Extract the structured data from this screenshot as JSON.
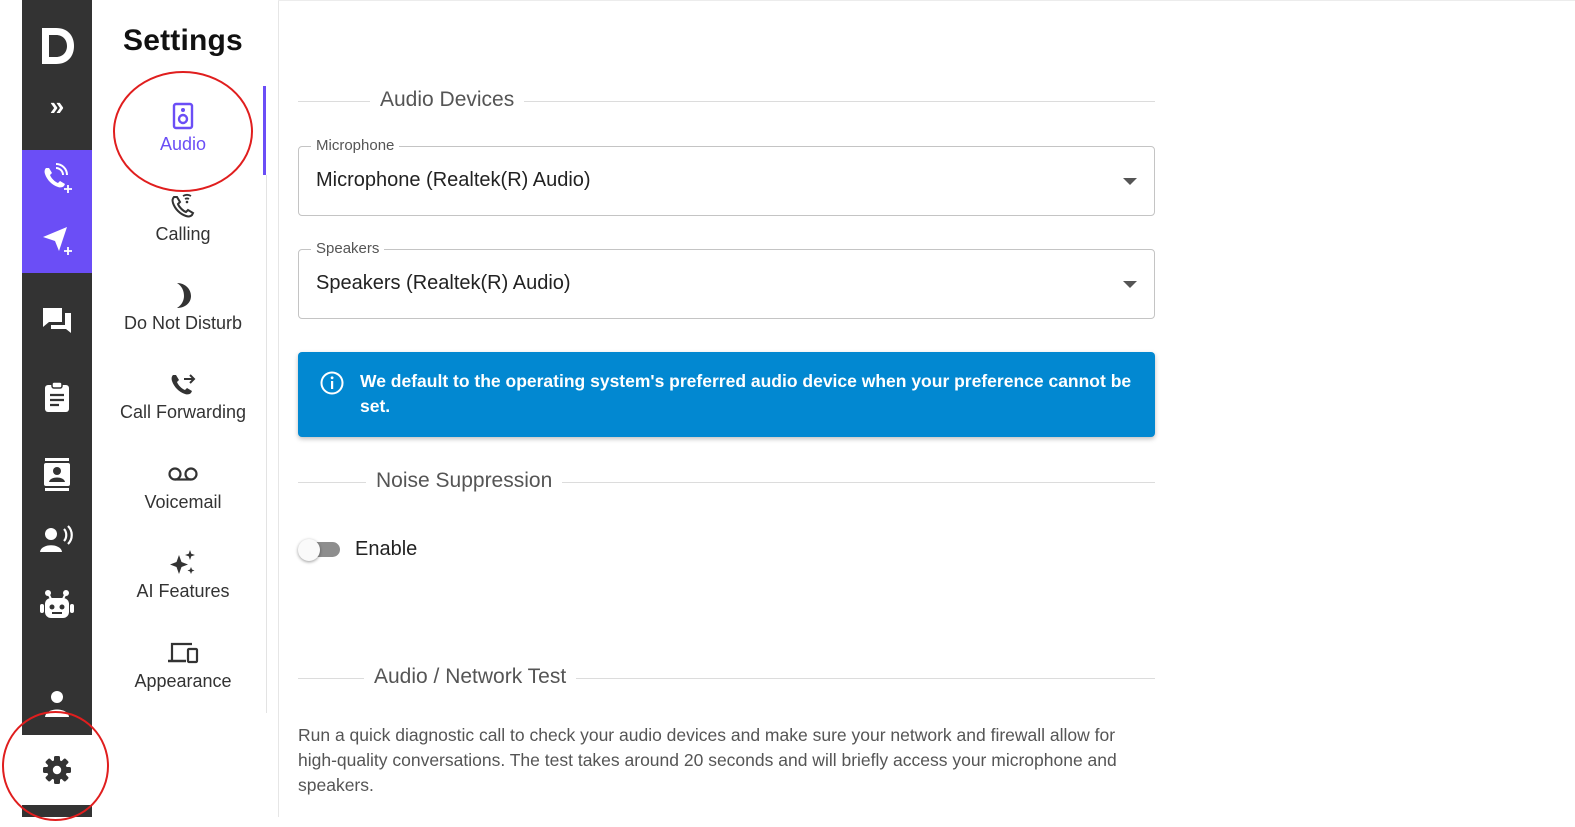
{
  "rail": {
    "logo": "D",
    "expand_glyph": "»",
    "icons": [
      "phone-add-icon",
      "send-add-icon",
      "chat-icon",
      "clipboard-icon",
      "contacts-icon",
      "speaking-person-icon",
      "robot-icon",
      "user-icon",
      "gear-icon"
    ]
  },
  "nav": {
    "title": "Settings",
    "items": [
      {
        "label": "Audio",
        "icon": "speaker-icon",
        "active": true
      },
      {
        "label": "Calling",
        "icon": "phone-wifi-icon",
        "active": false
      },
      {
        "label": "Do Not Disturb",
        "icon": "moon-icon",
        "active": false
      },
      {
        "label": "Call Forwarding",
        "icon": "phone-forward-icon",
        "active": false
      },
      {
        "label": "Voicemail",
        "icon": "voicemail-icon",
        "active": false
      },
      {
        "label": "AI Features",
        "icon": "sparkles-icon",
        "active": false
      },
      {
        "label": "Appearance",
        "icon": "devices-icon",
        "active": false
      }
    ]
  },
  "main": {
    "audio_devices_heading": "Audio Devices",
    "microphone": {
      "label": "Microphone",
      "value": "Microphone (Realtek(R) Audio)"
    },
    "speakers": {
      "label": "Speakers",
      "value": "Speakers (Realtek(R) Audio)"
    },
    "info_alert": "We default to the operating system's preferred audio device when your preference cannot be set.",
    "noise_heading": "Noise Suppression",
    "noise_toggle_label": "Enable",
    "noise_enabled": false,
    "test_heading": "Audio / Network Test",
    "test_description": "Run a quick diagnostic call to check your audio devices and make sure your network and firewall allow for high-quality conversations. The test takes around 20 seconds and will briefly access your microphone and speakers."
  },
  "colors": {
    "accent": "#6b4ef6",
    "rail": "#333333",
    "info": "#0288d1",
    "annotation": "#e01e1e"
  }
}
